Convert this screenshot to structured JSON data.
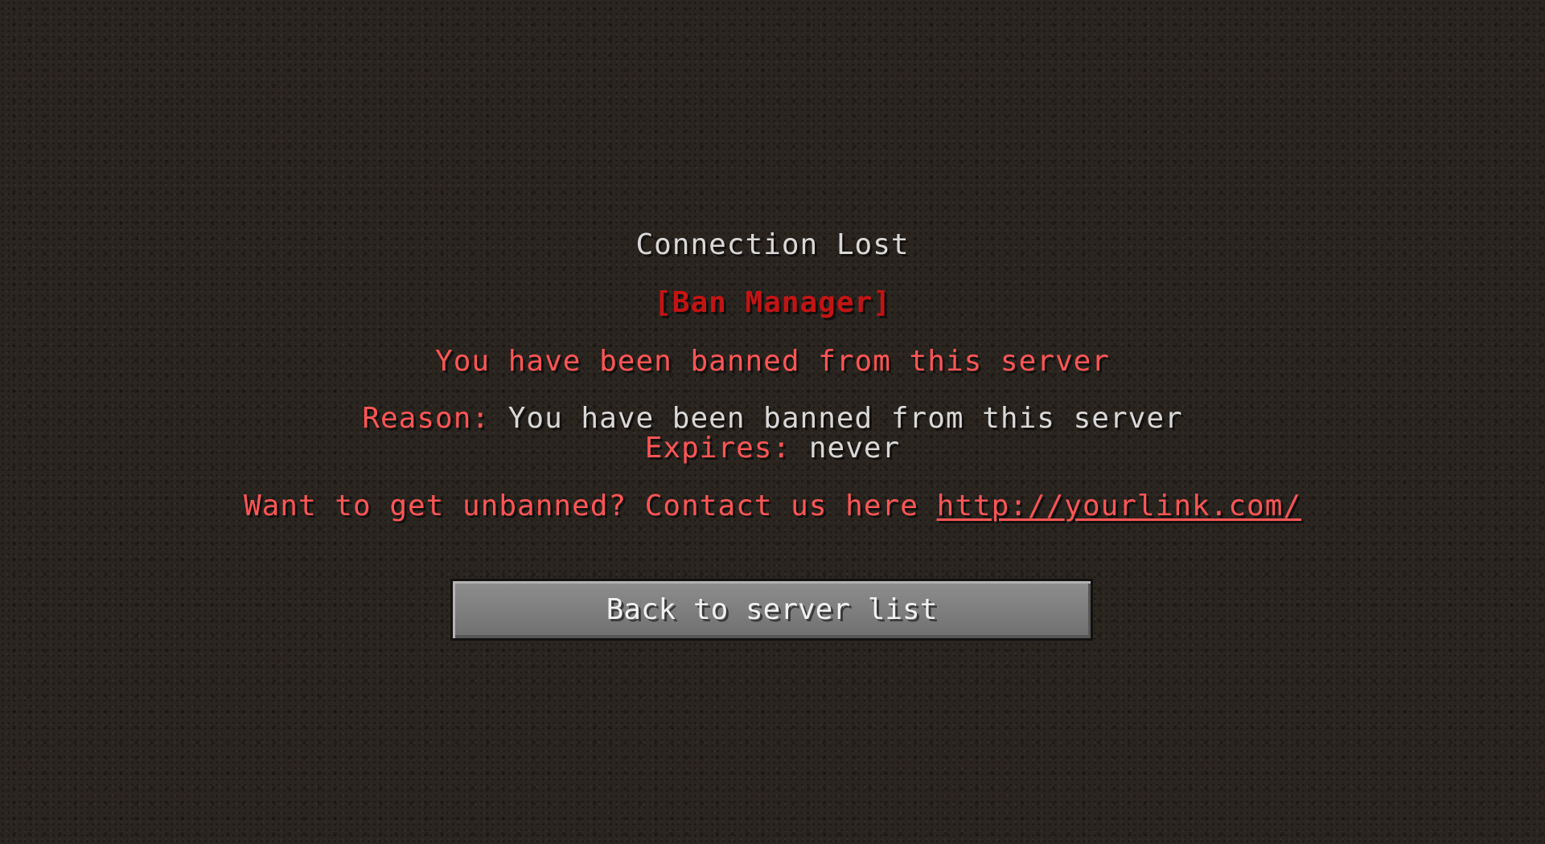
{
  "screen": {
    "title": "Connection Lost",
    "manager_tag": "[Ban Manager]",
    "banned_message": "You have been banned from this server",
    "reason_label": "Reason:",
    "reason_value": "You have been banned from this server",
    "expires_label": "Expires:",
    "expires_value": "never",
    "contact_text": "Want to get unbanned? Contact us here",
    "contact_link": "http://yourlink.com/"
  },
  "buttons": {
    "back_label": "Back to server list"
  },
  "colors": {
    "grey_text": "#d8d8d8",
    "red_text": "#ff5555",
    "dark_red_text": "#c31414",
    "button_face": "#7f7f7f"
  }
}
